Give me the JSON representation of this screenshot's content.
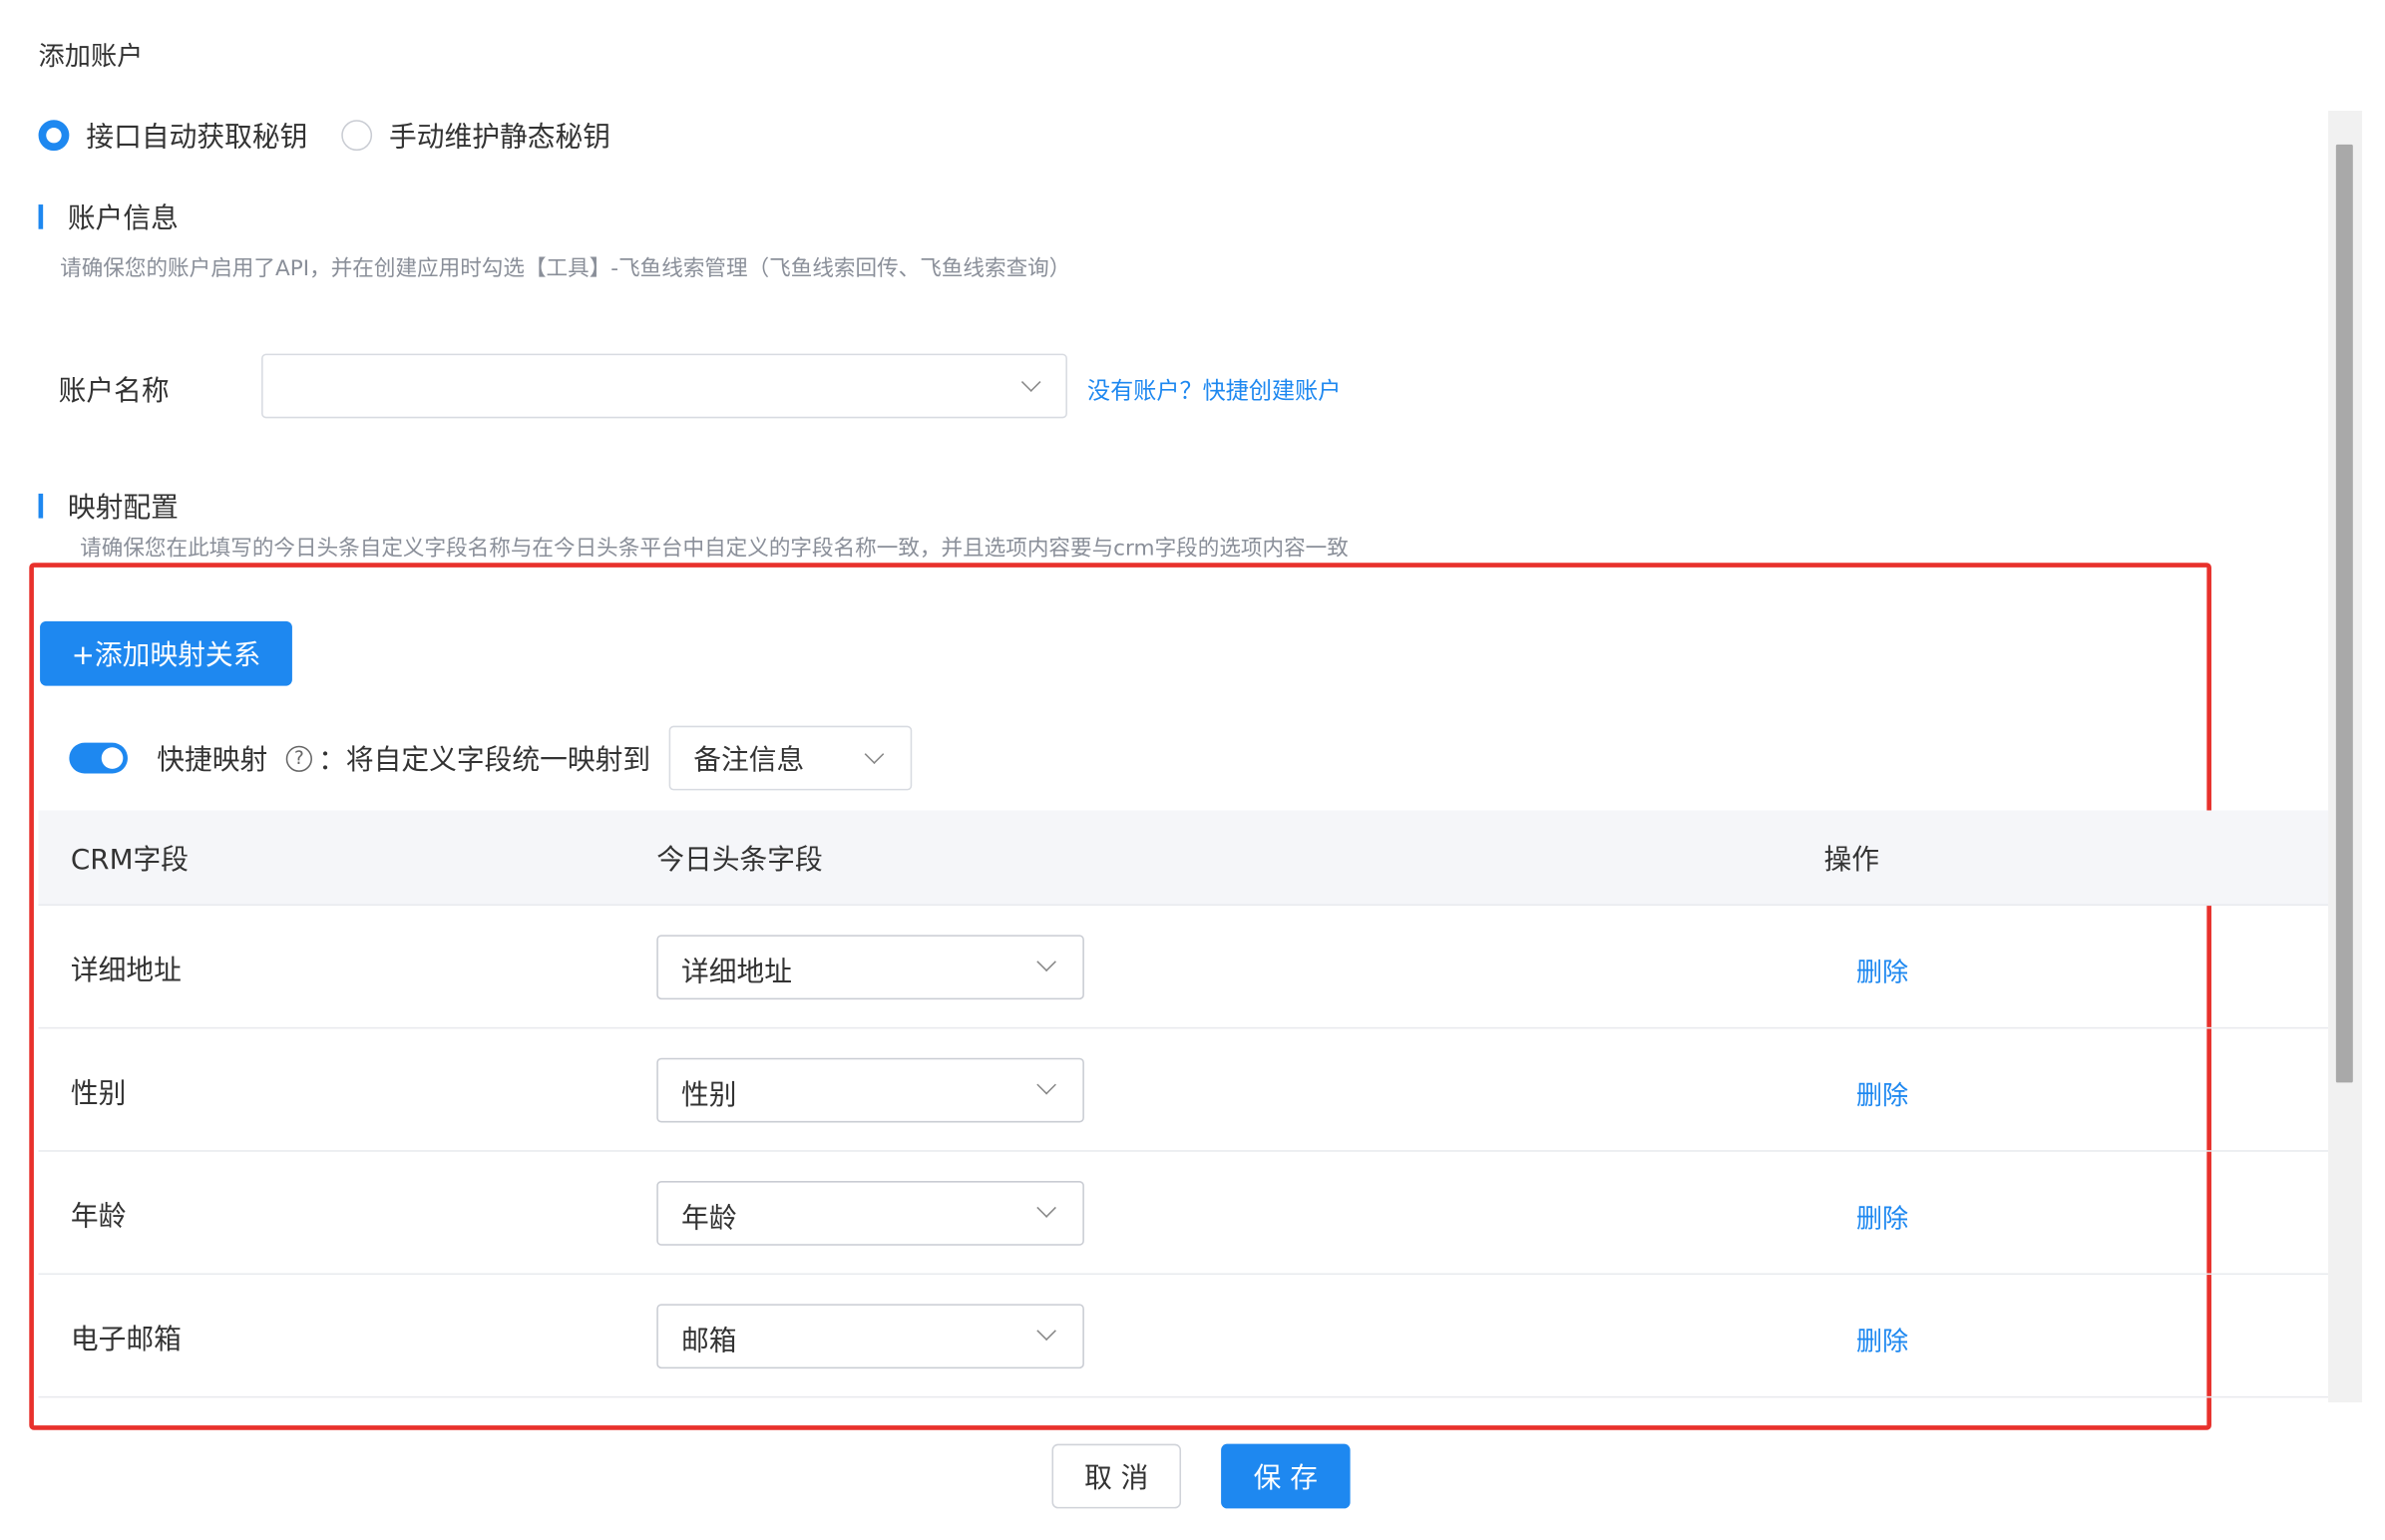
{
  "dialog": {
    "title": "添加账户"
  },
  "auth_mode": {
    "options": [
      {
        "label": "接口自动获取秘钥",
        "checked": true
      },
      {
        "label": "手动维护静态秘钥",
        "checked": false
      }
    ]
  },
  "account_section": {
    "title": "账户信息",
    "tip": "请确保您的账户启用了API，并在创建应用时勾选【工具】-飞鱼线索管理（飞鱼线索回传、飞鱼线索查询）",
    "account_name_label": "账户名称",
    "account_name_value": "",
    "create_link": "没有账户？快捷创建账户"
  },
  "mapping_section": {
    "title": "映射配置",
    "tip": "请确保您在此填写的今日头条自定义字段名称与在今日头条平台中自定义的字段名称一致，并且选项内容要与crm字段的选项内容一致",
    "add_button": "+添加映射关系",
    "quick_map": {
      "enabled": true,
      "label": "快捷映射",
      "help": "?",
      "desc": "：将自定义字段统一映射到",
      "target": "备注信息"
    },
    "table": {
      "headers": {
        "crm": "CRM字段",
        "toutiao": "今日头条字段",
        "action": "操作"
      },
      "rows": [
        {
          "crm": "详细地址",
          "toutiao": "详细地址",
          "action": "删除"
        },
        {
          "crm": "性别",
          "toutiao": "性别",
          "action": "删除"
        },
        {
          "crm": "年龄",
          "toutiao": "年龄",
          "action": "删除"
        },
        {
          "crm": "电子邮箱",
          "toutiao": "邮箱",
          "action": "删除"
        }
      ]
    }
  },
  "footer": {
    "cancel": "取 消",
    "save": "保 存"
  },
  "colors": {
    "primary": "#1e88f0",
    "highlight": "#e8312c"
  }
}
